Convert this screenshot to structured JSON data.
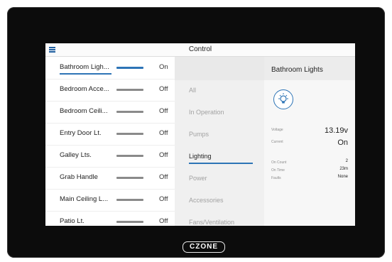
{
  "header": {
    "title": "Control"
  },
  "devices": [
    {
      "name": "Bathroom Ligh...",
      "state": "On",
      "on": true
    },
    {
      "name": "Bedroom Acce...",
      "state": "Off",
      "on": false
    },
    {
      "name": "Bedroom Ceili...",
      "state": "Off",
      "on": false
    },
    {
      "name": "Entry Door Lt.",
      "state": "Off",
      "on": false
    },
    {
      "name": "Galley Lts.",
      "state": "Off",
      "on": false
    },
    {
      "name": "Grab Handle",
      "state": "Off",
      "on": false
    },
    {
      "name": "Main Ceiling L...",
      "state": "Off",
      "on": false
    },
    {
      "name": "Patio Lt.",
      "state": "Off",
      "on": false
    }
  ],
  "categories": [
    {
      "label": "All"
    },
    {
      "label": "In Operation"
    },
    {
      "label": "Pumps"
    },
    {
      "label": "Lighting",
      "selected": true
    },
    {
      "label": "Power"
    },
    {
      "label": "Accessories"
    },
    {
      "label": "Fans/Ventilation"
    }
  ],
  "detail": {
    "title": "Bathroom Lights",
    "icon": "lightbulb-icon",
    "voltage_label": "Voltage",
    "voltage_value": "13.19v",
    "current_label": "Current",
    "current_value": "On",
    "on_count_label": "On Count",
    "on_count_value": "2",
    "on_time_label": "On Time",
    "on_time_value": "23m",
    "faults_label": "Faults",
    "faults_value": "None"
  },
  "brand": {
    "logo_text": "CZONE"
  },
  "colors": {
    "accent": "#2d74b6",
    "bezel": "#0c0c0c"
  }
}
